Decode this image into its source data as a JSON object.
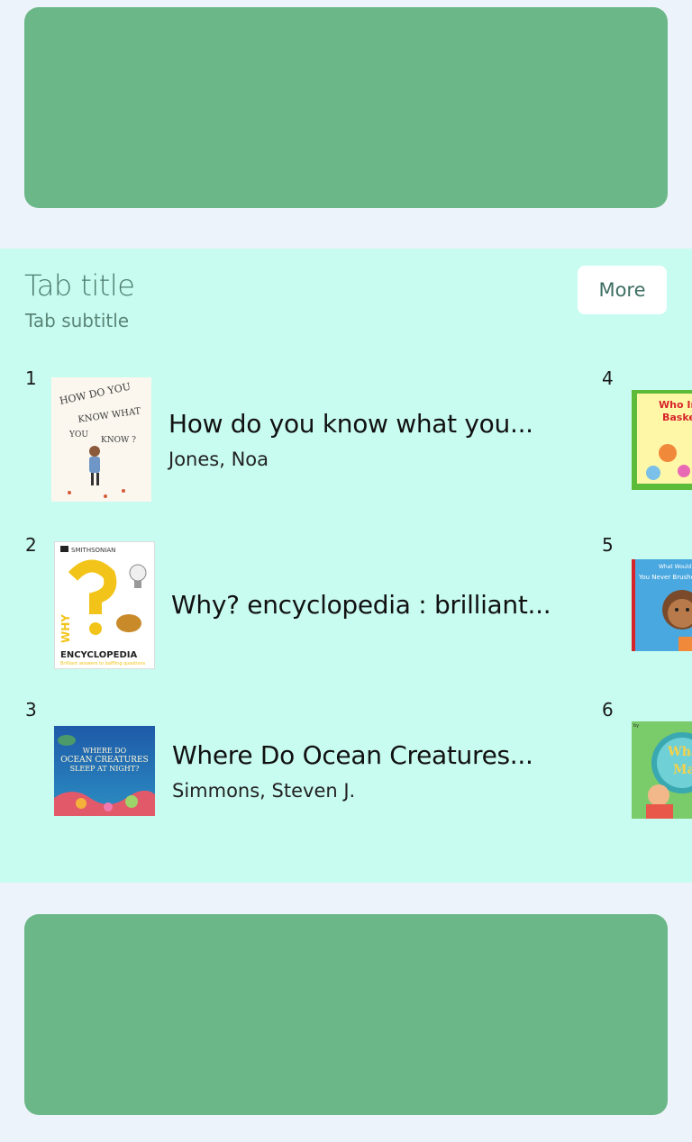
{
  "section": {
    "title": "Tab title",
    "subtitle": "Tab subtitle",
    "more_label": "More"
  },
  "books": [
    {
      "rank": "1",
      "title": "How do you know what you...",
      "author": "Jones, Noa",
      "cover_text": "HOW DO YOU KNOW WHAT YOU KNOW?"
    },
    {
      "rank": "2",
      "title": "Why? encyclopedia : brilliant...",
      "author": "",
      "cover_text": "SMITHSONIAN WHY? ENCYCLOPEDIA"
    },
    {
      "rank": "3",
      "title": "Where Do Ocean Creatures...",
      "author": "Simmons, Steven J.",
      "cover_text": "WHERE DO OCEAN CREATURES SLEEP AT NIGHT?"
    },
    {
      "rank": "4",
      "cover_text": "Who Inv Baskett"
    },
    {
      "rank": "5",
      "cover_text": "What Would H You Never Brushe"
    },
    {
      "rank": "6",
      "cover_text": "What Math"
    }
  ],
  "colors": {
    "page_bg": "#EDF3FA",
    "banner": "#6BB788",
    "section_bg": "#C8FCF0"
  }
}
